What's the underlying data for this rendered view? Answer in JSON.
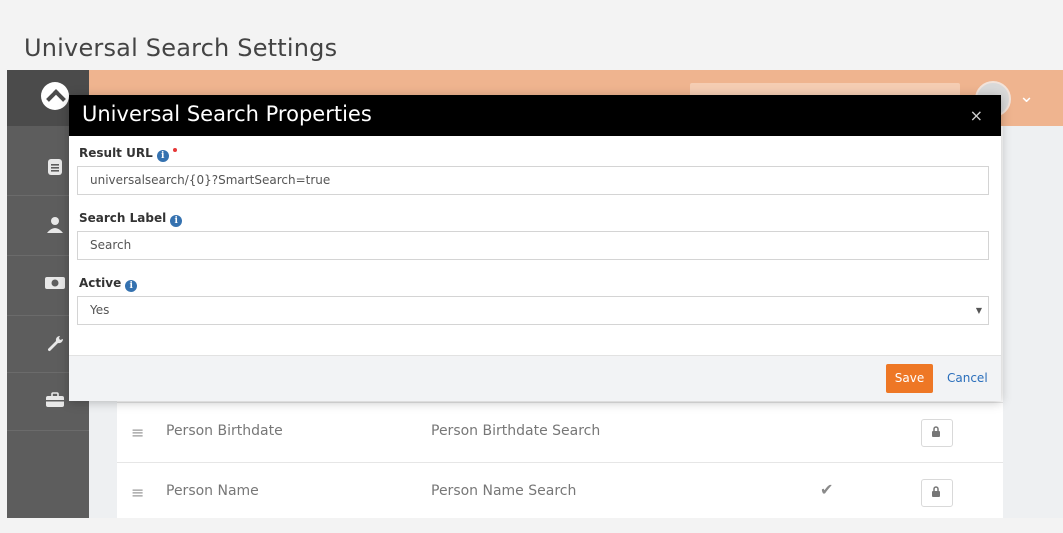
{
  "page": {
    "title": "Universal Search Settings"
  },
  "modal": {
    "title": "Universal Search Properties",
    "close_glyph": "×",
    "fields": [
      {
        "label": "Result URL",
        "required": true,
        "value": "universalsearch/{0}?SmartSearch=true"
      },
      {
        "label": "Search Label",
        "required": false,
        "value": "Search"
      },
      {
        "label": "Active",
        "required": false,
        "value": "Yes"
      }
    ],
    "info_glyph": "i",
    "save_label": "Save",
    "cancel_label": "Cancel"
  },
  "table": {
    "rows": [
      {
        "name": "Person Birthdate",
        "description": "Person Birthdate Search",
        "active": false
      },
      {
        "name": "Person Name",
        "description": "Person Name Search",
        "active": true
      }
    ]
  },
  "icons": {
    "drag": "≡",
    "check": "✔",
    "caret": "⌄",
    "select_caret": "▼"
  },
  "colors": {
    "header": "#efb48f",
    "sidebar": "#5d5d5d",
    "accent_button": "#ee7725",
    "link": "#2a6ebb",
    "info": "#3572b0",
    "required": "#e63939"
  }
}
